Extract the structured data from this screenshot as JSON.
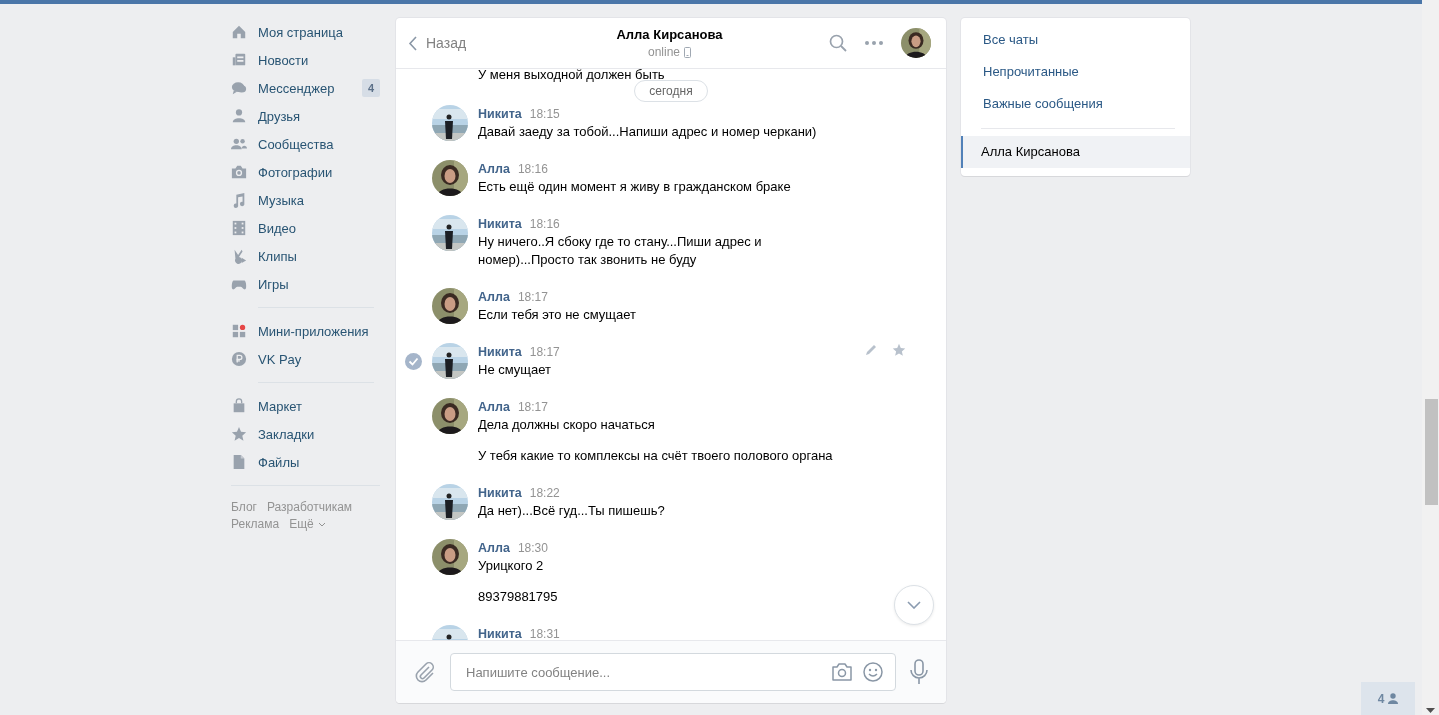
{
  "nav": {
    "groups": [
      [
        {
          "label": "Моя страница"
        },
        {
          "label": "Новости"
        },
        {
          "label": "Мессенджер",
          "badge": "4"
        },
        {
          "label": "Друзья"
        },
        {
          "label": "Сообщества"
        },
        {
          "label": "Фотографии"
        },
        {
          "label": "Музыка"
        },
        {
          "label": "Видео"
        },
        {
          "label": "Клипы"
        },
        {
          "label": "Игры"
        }
      ],
      [
        {
          "label": "Мини-приложения"
        },
        {
          "label": "VK Pay"
        }
      ],
      [
        {
          "label": "Маркет"
        },
        {
          "label": "Закладки"
        },
        {
          "label": "Файлы"
        }
      ]
    ],
    "footer_links": [
      "Блог",
      "Разработчикам",
      "Реклама",
      "Ещё"
    ]
  },
  "chat": {
    "back": "Назад",
    "title": "Алла Кирсанова",
    "status": "online",
    "messages": [
      {
        "kind": "text",
        "texts": [
          "У меня выходной должен быть"
        ]
      },
      {
        "kind": "date",
        "label": "сегодня"
      },
      {
        "kind": "group",
        "author": "Никита",
        "time": "18:15",
        "outgoing": true,
        "selected": false,
        "texts": [
          "Давай заеду за тобой...Напиши адрес и номер черкани)"
        ]
      },
      {
        "kind": "group",
        "author": "Алла",
        "time": "18:16",
        "outgoing": false,
        "selected": false,
        "texts": [
          "Есть ещё один момент я живу в гражданском браке"
        ]
      },
      {
        "kind": "group",
        "author": "Никита",
        "time": "18:16",
        "outgoing": true,
        "selected": false,
        "texts": [
          "Ну ничего..Я сбоку где то стану...Пиши адрес и номер)...Просто так звонить не буду"
        ]
      },
      {
        "kind": "group",
        "author": "Алла",
        "time": "18:17",
        "outgoing": false,
        "selected": false,
        "texts": [
          "Если тебя это не смущает"
        ]
      },
      {
        "kind": "group",
        "author": "Никита",
        "time": "18:17",
        "outgoing": true,
        "selected": true,
        "texts": [
          "Не смущает"
        ]
      },
      {
        "kind": "group",
        "author": "Алла",
        "time": "18:17",
        "outgoing": false,
        "selected": false,
        "texts": [
          "Дела должны скоро начаться",
          "У тебя какие то комплексы на счёт твоего полового органа"
        ]
      },
      {
        "kind": "group",
        "author": "Никита",
        "time": "18:22",
        "outgoing": true,
        "selected": false,
        "texts": [
          "Да нет)...Всё гуд...Ты пишешь?"
        ]
      },
      {
        "kind": "group",
        "author": "Алла",
        "time": "18:30",
        "outgoing": false,
        "selected": false,
        "texts": [
          "Урицкого 2",
          "89379881795"
        ]
      },
      {
        "kind": "group",
        "author": "Никита",
        "time": "18:31",
        "outgoing": true
      }
    ],
    "composer": {
      "placeholder": "Напишите сообщение..."
    }
  },
  "folders": {
    "items": [
      {
        "label": "Все чаты",
        "selected": false
      },
      {
        "label": "Непрочитанные",
        "selected": false
      },
      {
        "label": "Важные сообщения",
        "selected": false
      },
      {
        "label": "Алла Кирсанова",
        "selected": true
      }
    ]
  },
  "online_counter": "4"
}
